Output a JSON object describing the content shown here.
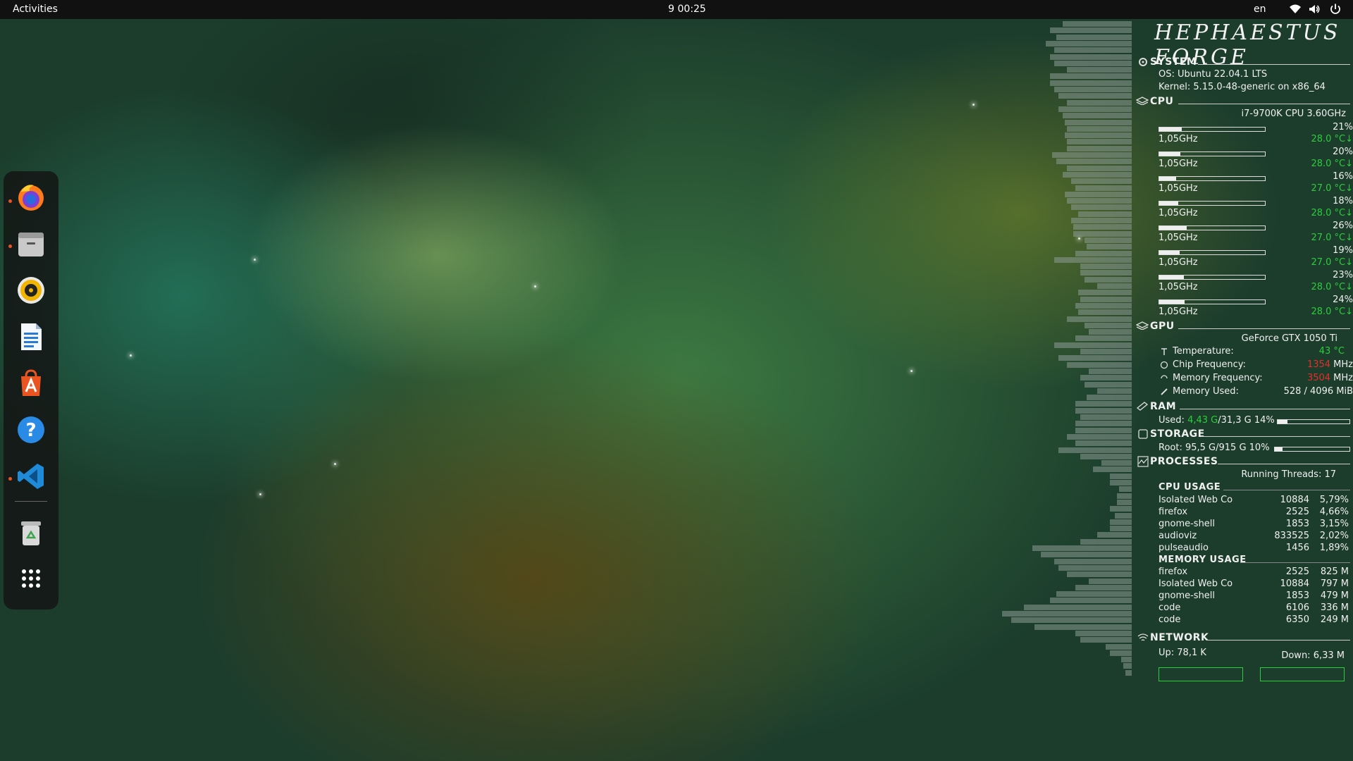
{
  "topbar": {
    "activities": "Activities",
    "clock": "9  00:25",
    "lang": "en"
  },
  "dock": {
    "apps": [
      {
        "name": "firefox-icon",
        "running": true
      },
      {
        "name": "files-icon",
        "running": true
      },
      {
        "name": "rhythmbox-icon",
        "running": false
      },
      {
        "name": "writer-icon",
        "running": false
      },
      {
        "name": "software-icon",
        "running": false
      },
      {
        "name": "help-icon",
        "running": false
      },
      {
        "name": "vscode-icon",
        "running": true
      },
      {
        "name": "trash-icon",
        "running": false
      },
      {
        "name": "show-apps-icon",
        "running": false
      }
    ]
  },
  "conky": {
    "title": "HEPHAESTUS FORGE",
    "system": {
      "header": "SYSTEM",
      "os": "OS: Ubuntu 22.04.1 LTS",
      "kernel": "Kernel: 5.15.0-48-generic on x86_64"
    },
    "cpu": {
      "header": "CPU",
      "model": "i7-9700K CPU  3.60GHz",
      "cores": [
        {
          "pct": "21%",
          "freq": "1,05GHz",
          "temp": "28.0 °C",
          "level": 0.21
        },
        {
          "pct": "20%",
          "freq": "1,05GHz",
          "temp": "28.0 °C",
          "level": 0.2
        },
        {
          "pct": "16%",
          "freq": "1,05GHz",
          "temp": "27.0 °C",
          "level": 0.16
        },
        {
          "pct": "18%",
          "freq": "1,05GHz",
          "temp": "28.0 °C",
          "level": 0.18
        },
        {
          "pct": "26%",
          "freq": "1,05GHz",
          "temp": "27.0 °C",
          "level": 0.26
        },
        {
          "pct": "19%",
          "freq": "1,05GHz",
          "temp": "27.0 °C",
          "level": 0.19
        },
        {
          "pct": "23%",
          "freq": "1,05GHz",
          "temp": "28.0 °C",
          "level": 0.23
        },
        {
          "pct": "24%",
          "freq": "1,05GHz",
          "temp": "28.0 °C",
          "level": 0.24
        }
      ]
    },
    "gpu": {
      "header": "GPU",
      "model": "GeForce GTX 1050 Ti",
      "temp_label": "Temperature:",
      "temp_val": "43 °C",
      "chip_label": "Chip Frequency:",
      "chip_val": "1354",
      "chip_unit": "MHz",
      "mem_label": "Memory Frequency:",
      "mem_val": "3504",
      "mem_unit": "MHz",
      "used_label": "Memory Used:",
      "used_val": "528 / 4096 MiB"
    },
    "ram": {
      "header": "RAM",
      "used_prefix": "Used: ",
      "used_val": "4,43 G",
      "used_rest": "/31,3 G 14%",
      "level": 0.14
    },
    "storage": {
      "header": "STORAGE",
      "root": "Root: 95,5 G/915 G  10%",
      "level": 0.1
    },
    "processes": {
      "header": "PROCESSES",
      "threads": "Running Threads: 17",
      "cpu_header": "CPU USAGE",
      "cpu_rows": [
        {
          "name": "Isolated Web Co",
          "pid": "10884",
          "val": "5,79%"
        },
        {
          "name": "firefox",
          "pid": "2525",
          "val": "4,66%"
        },
        {
          "name": "gnome-shell",
          "pid": "1853",
          "val": "3,15%"
        },
        {
          "name": "audioviz",
          "pid": "833525",
          "val": "2,02%"
        },
        {
          "name": "pulseaudio",
          "pid": "1456",
          "val": "1,89%"
        }
      ],
      "mem_header": "MEMORY USAGE",
      "mem_rows": [
        {
          "name": "firefox",
          "pid": "2525",
          "val": "825 M"
        },
        {
          "name": "Isolated Web Co",
          "pid": "10884",
          "val": "797 M"
        },
        {
          "name": "gnome-shell",
          "pid": "1853",
          "val": "479 M"
        },
        {
          "name": "code",
          "pid": "6106",
          "val": "336 M"
        },
        {
          "name": "code",
          "pid": "6350",
          "val": "249 M"
        }
      ]
    },
    "network": {
      "header": "NETWORK",
      "up": "Up: 78,1 K",
      "down": "Down: 6,33 M"
    },
    "visualizer_levels": [
      0.32,
      0.38,
      0.35,
      0.4,
      0.36,
      0.38,
      0.36,
      0.3,
      0.38,
      0.38,
      0.36,
      0.34,
      0.3,
      0.34,
      0.32,
      0.31,
      0.3,
      0.31,
      0.3,
      0.3,
      0.37,
      0.35,
      0.3,
      0.32,
      0.28,
      0.26,
      0.31,
      0.3,
      0.28,
      0.25,
      0.28,
      0.27,
      0.27,
      0.22,
      0.21,
      0.26,
      0.36,
      0.24,
      0.24,
      0.22,
      0.16,
      0.25,
      0.24,
      0.26,
      0.25,
      0.3,
      0.22,
      0.2,
      0.26,
      0.36,
      0.24,
      0.34,
      0.3,
      0.2,
      0.24,
      0.22,
      0.16,
      0.21,
      0.26,
      0.26,
      0.24,
      0.26,
      0.26,
      0.3,
      0.26,
      0.34,
      0.24,
      0.14,
      0.18,
      0.1,
      0.1,
      0.06,
      0.07,
      0.07,
      0.1,
      0.08,
      0.1,
      0.1,
      0.16,
      0.24,
      0.46,
      0.42,
      0.36,
      0.34,
      0.3,
      0.2,
      0.26,
      0.35,
      0.38,
      0.5,
      0.6,
      0.56,
      0.45,
      0.26,
      0.24,
      0.12,
      0.1,
      0.05,
      0.04,
      0.03
    ]
  }
}
